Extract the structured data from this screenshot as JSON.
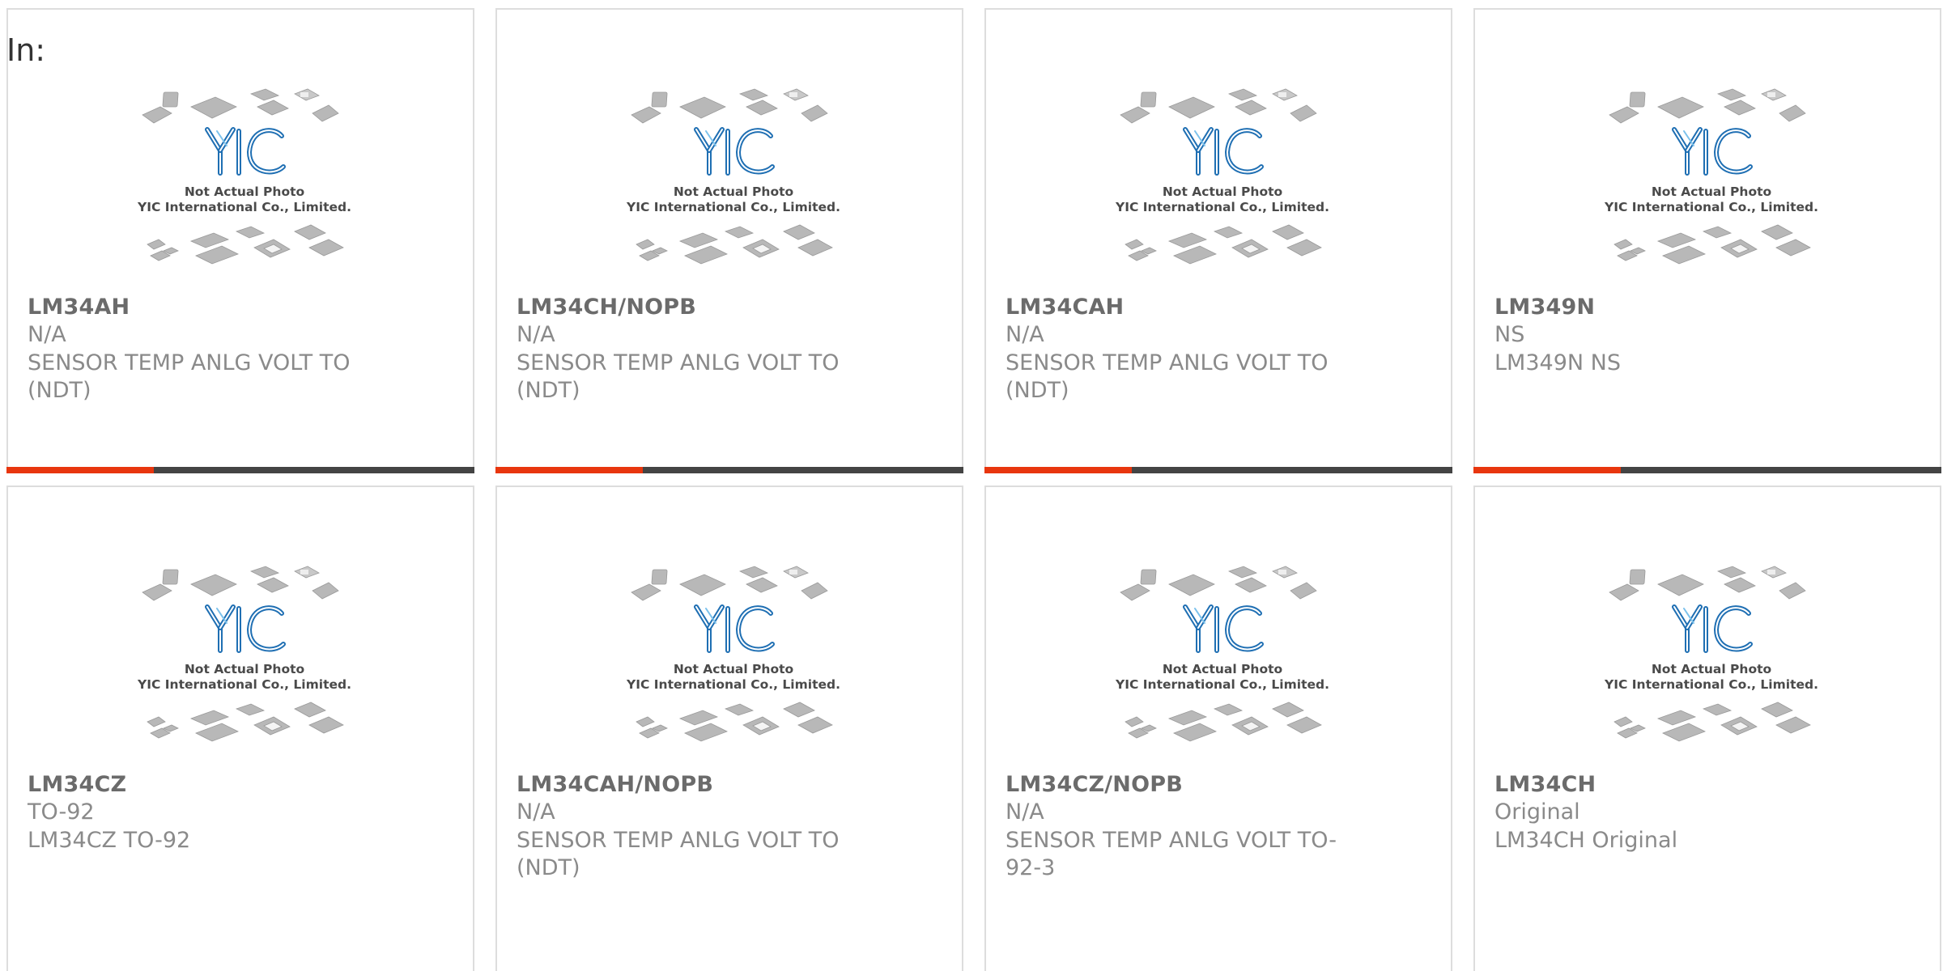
{
  "header": {
    "in_label": "In:"
  },
  "thumbnail": {
    "line1": "Not Actual Photo",
    "line2": "YIC International Co., Limited.",
    "brand_color": "#2b8fd0",
    "chip_color": "#b5b5b5"
  },
  "colors": {
    "accent": "#e8360e",
    "bar": "#444444",
    "border": "#dddddd"
  },
  "products": [
    {
      "part": "LM34AH",
      "package": "N/A",
      "description": "SENSOR TEMP ANLG VOLT TO (NDT)"
    },
    {
      "part": "LM34CH/NOPB",
      "package": "N/A",
      "description": "SENSOR TEMP ANLG VOLT TO (NDT)"
    },
    {
      "part": "LM34CAH",
      "package": "N/A",
      "description": "SENSOR TEMP ANLG VOLT TO (NDT)"
    },
    {
      "part": "LM349N",
      "package": "NS",
      "description": "LM349N NS"
    },
    {
      "part": "LM34CZ",
      "package": "TO-92",
      "description": "LM34CZ TO-92"
    },
    {
      "part": "LM34CAH/NOPB",
      "package": "N/A",
      "description": "SENSOR TEMP ANLG VOLT TO (NDT)"
    },
    {
      "part": "LM34CZ/NOPB",
      "package": "N/A",
      "description": "SENSOR TEMP ANLG VOLT TO-92-3"
    },
    {
      "part": "LM34CH",
      "package": "Original",
      "description": "LM34CH Original"
    }
  ]
}
